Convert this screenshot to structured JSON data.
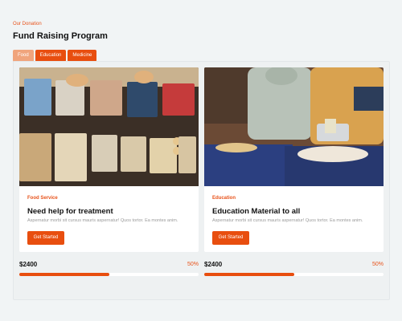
{
  "header": {
    "eyebrow": "Our Donation",
    "title": "Fund Raising Program"
  },
  "tabs": [
    {
      "label": "Food",
      "active": true
    },
    {
      "label": "Education",
      "active": false
    },
    {
      "label": "Medicine",
      "active": false
    }
  ],
  "cards": [
    {
      "category": "Food Service",
      "title": "Need help for treatment",
      "description": "Aspernatur morbi sit cursus mauris aspernatur! Quos tortor. Ea montes anim.",
      "button": "Get Started",
      "amount": "$2400",
      "progress_label": "50%",
      "progress": 0.5
    },
    {
      "category": "Education",
      "title": "Education Material to all",
      "description": "Aspernatur morbi sit cursus mauris aspernatur! Quos tortor. Ea montes anim.",
      "button": "Get Started",
      "amount": "$2400",
      "progress_label": "50%",
      "progress": 0.5
    }
  ],
  "colors": {
    "accent": "#e84e0f",
    "accent_light": "#f0a47c",
    "background": "#f1f4f5"
  }
}
